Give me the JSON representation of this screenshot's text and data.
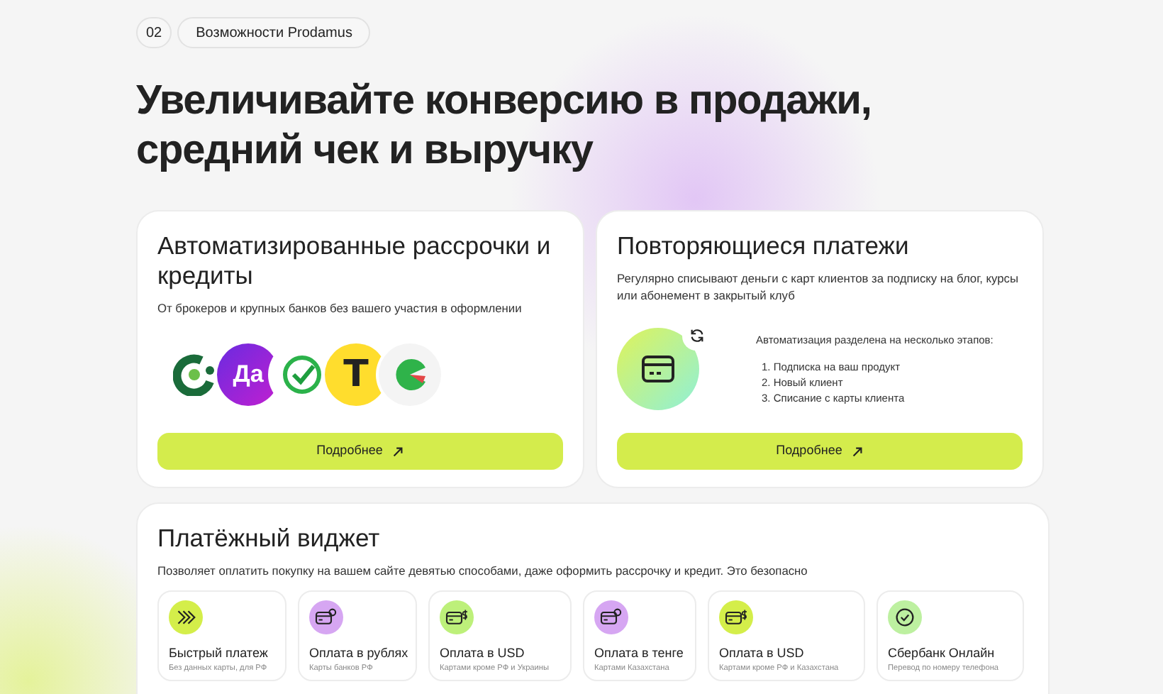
{
  "section": {
    "number": "02",
    "label": "Возможности Prodamus"
  },
  "heading": "Увеличивайте конверсию в продажи, средний чек и выручку",
  "installments": {
    "title": "Автоматизированные рассрочки и кредиты",
    "description": "От брокеров и крупных банков без вашего участия в оформлении",
    "logos": [
      {
        "kind": "ring"
      },
      {
        "kind": "letters",
        "text": "Да"
      },
      {
        "kind": "check"
      },
      {
        "kind": "letter",
        "text": "Т"
      },
      {
        "kind": "pie"
      }
    ],
    "button": "Подробнее"
  },
  "recurring": {
    "title": "Повторяющиеся платежи",
    "description": "Регулярно списывают деньги с карт клиентов за подписку на блог, курсы или абонемент в закрытый клуб",
    "intro": "Автоматизация разделена на несколько этапов:",
    "steps": [
      "1. Подписка на ваш продукт",
      "2. Новый клиент",
      "3. Списание с карты клиента"
    ],
    "button": "Подробнее"
  },
  "widget": {
    "title": "Платёжный виджет",
    "description": "Позволяет оплатить покупку на вашем сайте девятью способами, даже оформить рассрочку и кредит. Это безопасно",
    "methods": [
      {
        "kind": "chevrons",
        "color": "#d4ee4a",
        "title": "Быстрый платеж",
        "subtitle": "Без данных карты, для РФ"
      },
      {
        "kind": "card-coin",
        "color": "#d6a6f2",
        "title": "Оплата в рублях",
        "subtitle": "Карты банков РФ"
      },
      {
        "kind": "card-dollar",
        "color": "#bdf07a",
        "title": "Оплата в USD",
        "subtitle": "Картами кроме РФ и Украины"
      },
      {
        "kind": "card-coin",
        "color": "#d6a6f2",
        "title": "Оплата в тенге",
        "subtitle": "Картами Казахстана"
      },
      {
        "kind": "card-dollar",
        "color": "#d4ee4a",
        "title": "Оплата в USD",
        "subtitle": "Картами кроме РФ и Казахстана"
      },
      {
        "kind": "check",
        "color": "#bdf0a0",
        "title": "Сбербанк Онлайн",
        "subtitle": "Перевод по номеру телефона"
      }
    ]
  }
}
